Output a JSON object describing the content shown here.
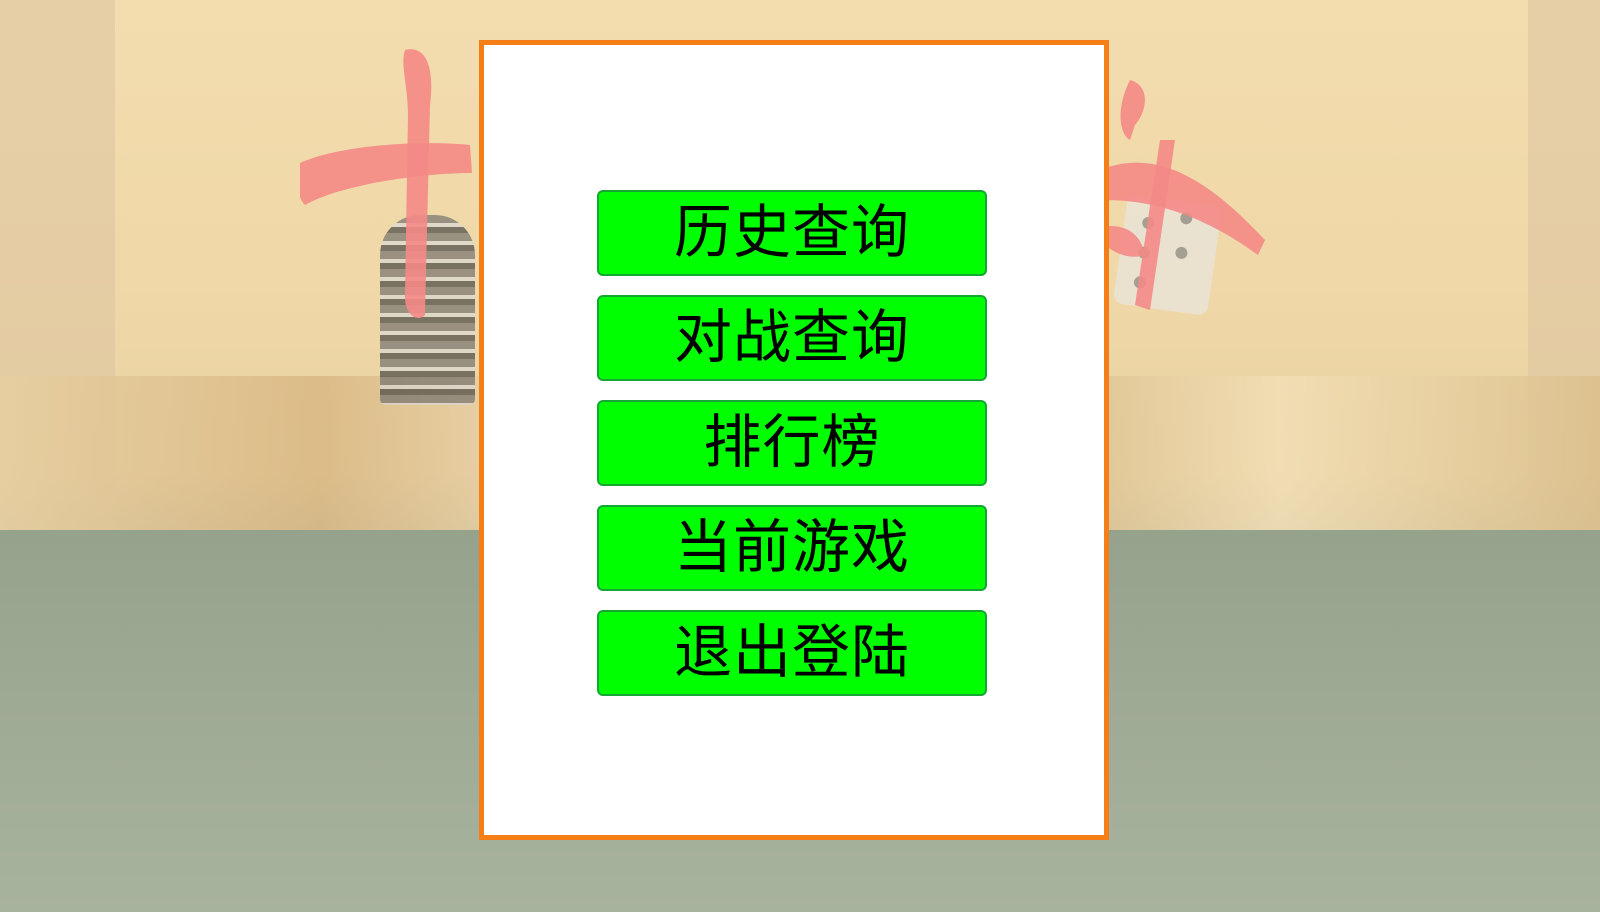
{
  "menu": {
    "items": [
      {
        "label": "历史查询"
      },
      {
        "label": "对战查询"
      },
      {
        "label": "排行榜"
      },
      {
        "label": "当前游戏"
      },
      {
        "label": "退出登陆"
      }
    ]
  },
  "colors": {
    "dialog_border": "#f57e16",
    "button_fill": "#00ff00",
    "button_border": "#14a833",
    "calligraphy": "#f48a86"
  },
  "background": {
    "elements": [
      "calligraphy-strokes",
      "poker-chips",
      "dice",
      "gold-ribbon",
      "green-table"
    ]
  }
}
